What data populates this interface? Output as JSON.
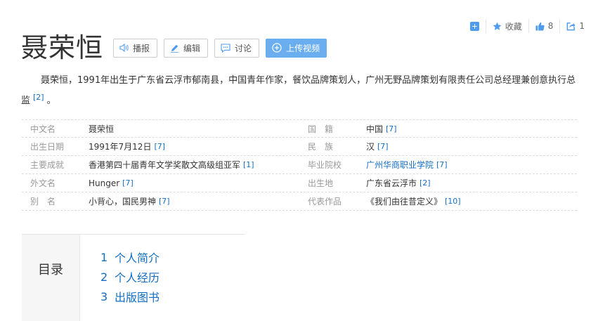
{
  "toolbar": {
    "collect_label": "收藏",
    "like_count": "8",
    "share_count": "1"
  },
  "title": "聂荣恒",
  "actions": {
    "play": "播报",
    "edit": "编辑",
    "discuss": "讨论",
    "upload": "上传视频"
  },
  "summary": {
    "text": "聂荣恒，1991年出生于广东省云浮市郁南县，中国青年作家，餐饮品牌策划人，广州无野品牌策划有限责任公司总经理兼创意执行总监",
    "ref": "[2]",
    "tail": "。"
  },
  "info": [
    {
      "left": {
        "label": "中文名",
        "value": "聂荣恒",
        "ref": ""
      },
      "right": {
        "label": "国　籍",
        "value": "中国",
        "ref": "[7]"
      }
    },
    {
      "left": {
        "label": "出生日期",
        "value": "1991年7月12日",
        "ref": "[7]"
      },
      "right": {
        "label": "民　族",
        "value": "汉",
        "ref": "[7]"
      }
    },
    {
      "left": {
        "label": "主要成就",
        "value": "香港第四十届青年文学奖散文高级组亚军",
        "ref": "[1]"
      },
      "right": {
        "label": "毕业院校",
        "value": "广州华商职业学院",
        "ref": "[7]",
        "link": true
      }
    },
    {
      "left": {
        "label": "外文名",
        "value": "Hunger",
        "ref": "[7]"
      },
      "right": {
        "label": "出生地",
        "value": "广东省云浮市",
        "ref": "[2]"
      }
    },
    {
      "left": {
        "label": "别　名",
        "value": "小背心，国民男神",
        "ref": "[7]"
      },
      "right": {
        "label": "代表作品",
        "value": "《我们由往昔定义》",
        "ref": "[10]"
      }
    }
  ],
  "catalog": {
    "title": "目录",
    "items": [
      {
        "num": "1",
        "label": "个人简介"
      },
      {
        "num": "2",
        "label": "个人经历"
      },
      {
        "num": "3",
        "label": "出版图书"
      }
    ]
  },
  "colors": {
    "link": "#136ec2",
    "accent": "#4f9cee",
    "primary_button": "#6aaef0"
  }
}
